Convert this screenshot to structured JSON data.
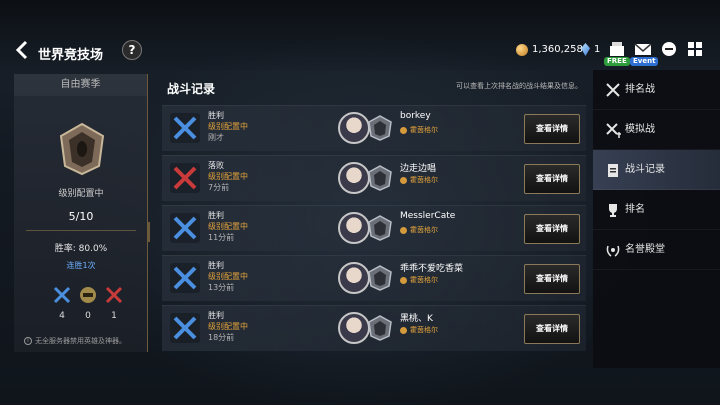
{
  "header": {
    "title": "世界竞技场",
    "help_label": "?",
    "gold": "1,360,258",
    "gems": "1",
    "free_badge": "FREE",
    "event_badge": "Event"
  },
  "season": {
    "label": "自由赛季",
    "rank_name": "级别配置中",
    "progress": "5/10",
    "winrate": "胜率: 80.0%",
    "streak": "连胜1次",
    "stats": {
      "win": "4",
      "draw": "0",
      "loss": "1"
    },
    "note": "无全服务器禁用英雄及神器。"
  },
  "main": {
    "title": "战斗记录",
    "hint": "可以查看上次排名战的战斗结果及信息。",
    "detail_label": "查看详情",
    "records": [
      {
        "result": "胜利",
        "config": "级别配置中",
        "time": "刚才",
        "player": "borkey",
        "server": "霍茵格尔",
        "win": true
      },
      {
        "result": "落败",
        "config": "级别配置中",
        "time": "7分前",
        "player": "边走边唱",
        "server": "霍茵格尔",
        "win": false
      },
      {
        "result": "胜利",
        "config": "级别配置中",
        "time": "11分前",
        "player": "MesslerCate",
        "server": "霍茵格尔",
        "win": true
      },
      {
        "result": "胜利",
        "config": "级别配置中",
        "time": "13分前",
        "player": "乖乖不爱吃香菜",
        "server": "霍茵格尔",
        "win": true
      },
      {
        "result": "胜利",
        "config": "级别配置中",
        "time": "18分前",
        "player": "黑桃、K",
        "server": "霍茵格尔",
        "win": true
      }
    ]
  },
  "nav": {
    "items": [
      {
        "label": "排名战",
        "icon": "crossed-swords-icon"
      },
      {
        "label": "模拟战",
        "icon": "crossed-swords-plus-icon"
      },
      {
        "label": "战斗记录",
        "icon": "clipboard-icon",
        "active": true
      },
      {
        "label": "排名",
        "icon": "trophy-icon"
      },
      {
        "label": "名誉殿堂",
        "icon": "laurel-icon"
      }
    ]
  },
  "colors": {
    "accent_gold": "#e3a33c",
    "win_blue": "#4a8fe0",
    "loss_red": "#c93a3a",
    "streak_blue": "#6fb0ff"
  }
}
